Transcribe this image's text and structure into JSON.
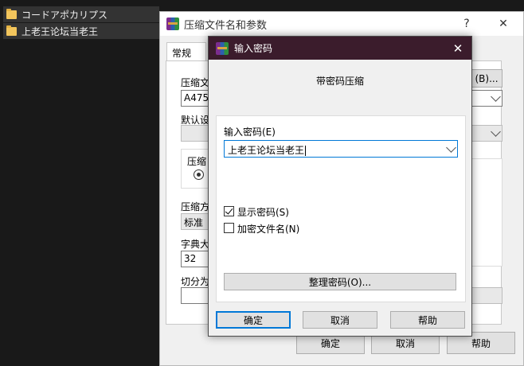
{
  "explorer": {
    "files": [
      {
        "name": "コードアポカリプス"
      },
      {
        "name": "上老王论坛当老王"
      }
    ]
  },
  "main_dialog": {
    "title": "压缩文件名和参数",
    "help_label": "?",
    "close_label": "✕",
    "tab_general": "常规",
    "archive_name_label": "压缩文",
    "archive_name_value": "A4751",
    "browse_label": "(B)...",
    "default_profile_label": "默认设",
    "archive_format_label": "压缩",
    "compress_method_label": "压缩方",
    "compress_method_value": "标准",
    "dict_size_label": "字典大",
    "dict_size_value": "32",
    "split_label": "切分为",
    "ok_label": "确定",
    "cancel_label": "取消",
    "help_button_label": "帮助"
  },
  "password_dialog": {
    "title": "输入密码",
    "close_label": "✕",
    "heading": "带密码压缩",
    "enter_password_label": "输入密码(E)",
    "password_value": "上老王论坛当老王",
    "show_password_label": "显示密码(S)",
    "show_password_checked": true,
    "encrypt_filenames_label": "加密文件名(N)",
    "encrypt_filenames_checked": false,
    "organize_label": "整理密码(O)...",
    "ok_label": "确定",
    "cancel_label": "取消",
    "help_label": "帮助"
  },
  "colors": {
    "pw_titlebar": "#3b1c2c",
    "focus_blue": "#0078d7"
  }
}
